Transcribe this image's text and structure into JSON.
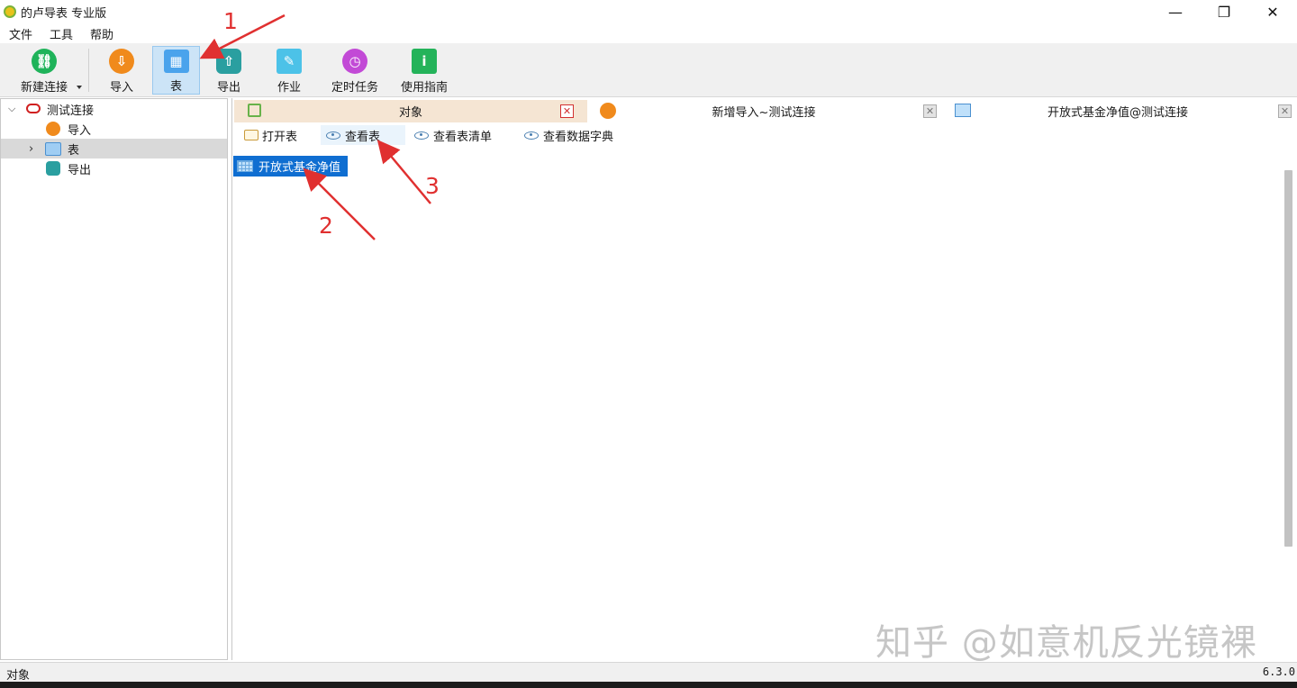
{
  "window": {
    "title": "的卢导表 专业版",
    "minimize": "—",
    "restore": "❐",
    "close": "✕"
  },
  "menu": [
    "文件",
    "工具",
    "帮助"
  ],
  "toolbar": [
    {
      "label": "新建连接",
      "icon": "link-icon",
      "color": "#1fb35a"
    },
    {
      "label": "导入",
      "icon": "import-icon",
      "color": "#f08a1c"
    },
    {
      "label": "表",
      "icon": "table-icon",
      "color": "#4aa3ec"
    },
    {
      "label": "导出",
      "icon": "export-icon",
      "color": "#2a9fa0"
    },
    {
      "label": "作业",
      "icon": "job-icon",
      "color": "#4cc2e8"
    },
    {
      "label": "定时任务",
      "icon": "timer-icon",
      "color": "#c24ad6"
    },
    {
      "label": "使用指南",
      "icon": "guide-icon",
      "color": "#24b35a"
    }
  ],
  "tree": {
    "root": "测试连接",
    "children": [
      "导入",
      "表",
      "导出"
    ]
  },
  "tabs": [
    {
      "label": "对象"
    },
    {
      "label": "新增导入~测试连接"
    },
    {
      "label": "开放式基金净值@测试连接"
    }
  ],
  "object_toolbar": [
    "打开表",
    "查看表",
    "查看表清单",
    "查看数据字典"
  ],
  "tables": [
    "开放式基金净值"
  ],
  "status": {
    "left": "对象",
    "version": "6.3.0"
  },
  "watermark": "知乎 @如意机反光镜裸",
  "annotations": [
    "1",
    "2",
    "3"
  ],
  "colors": {
    "accent": "#0f6ed1",
    "annotation": "#e03030",
    "active_tab": "#f5e5d3"
  }
}
